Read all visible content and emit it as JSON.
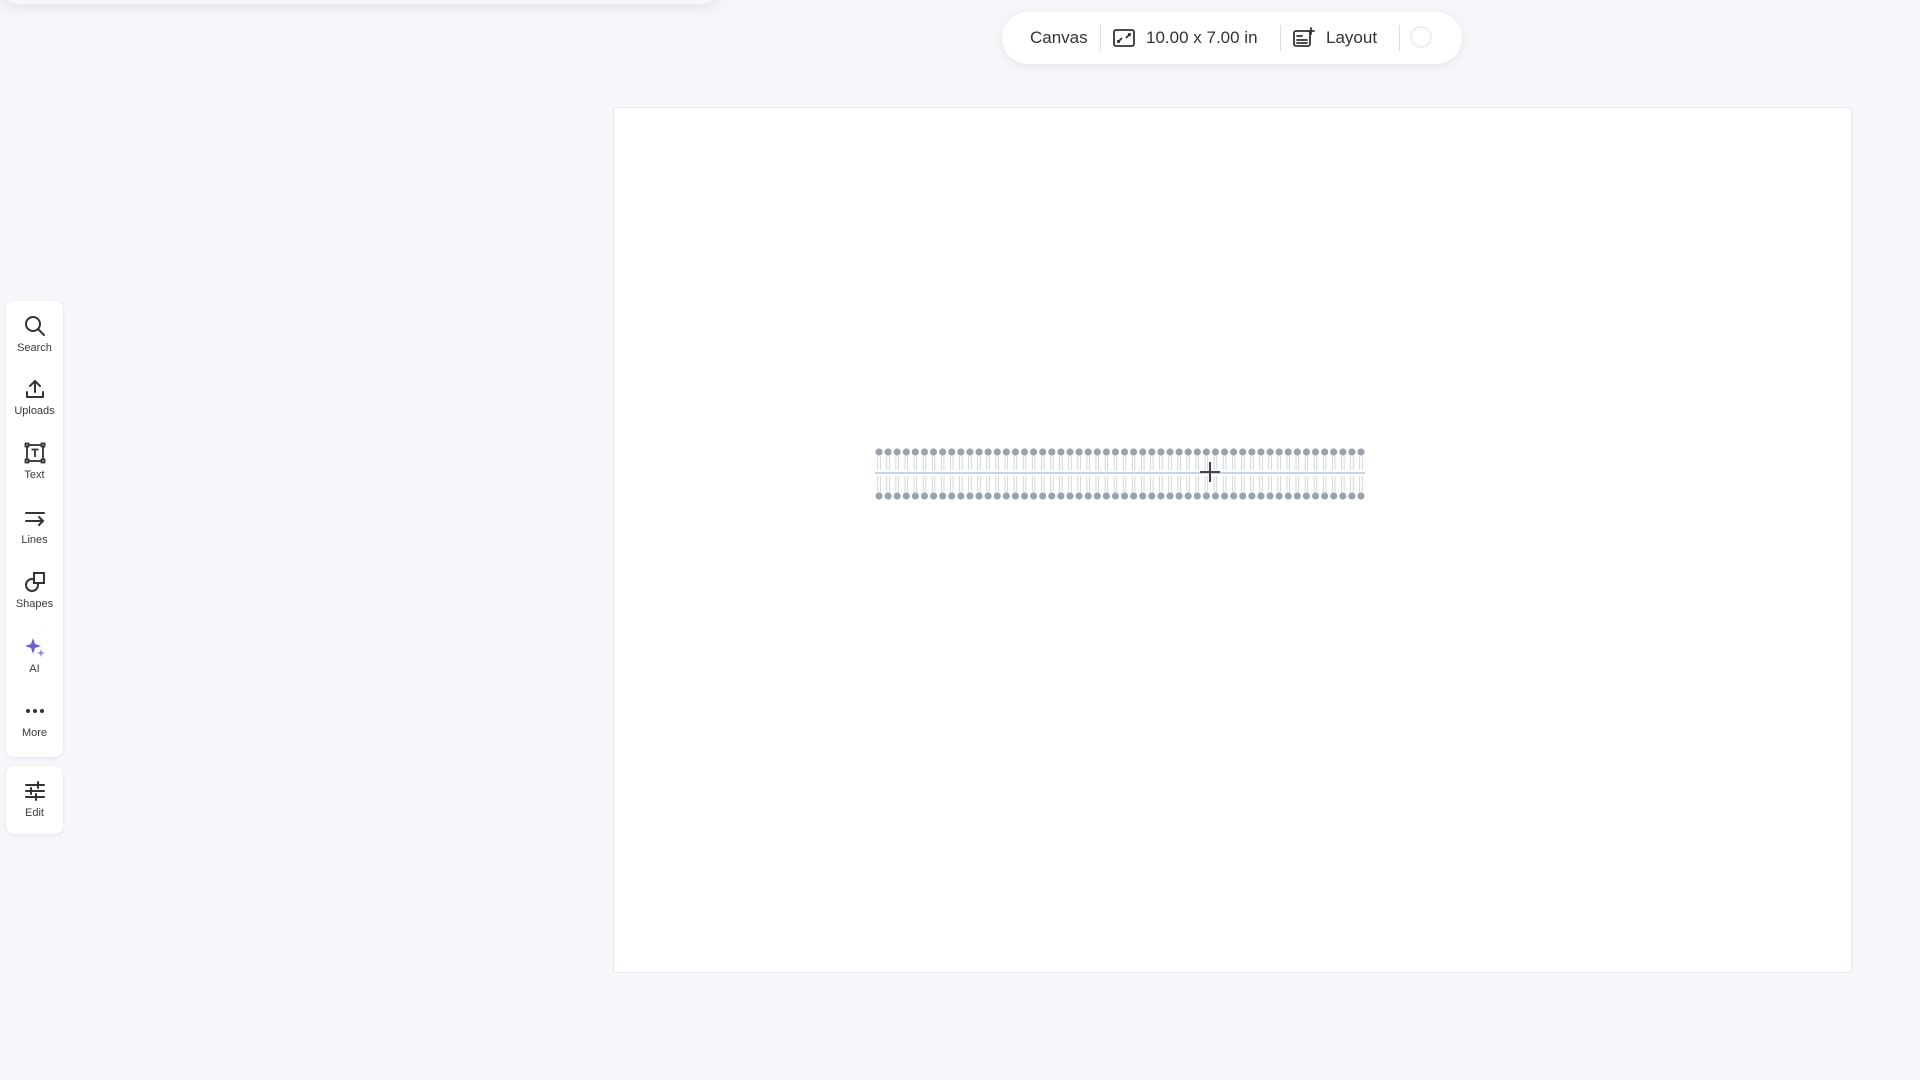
{
  "sidebar": {
    "items": [
      {
        "label": "Search",
        "icon": "search-icon"
      },
      {
        "label": "Uploads",
        "icon": "upload-icon"
      },
      {
        "label": "Text",
        "icon": "text-icon"
      },
      {
        "label": "Lines",
        "icon": "lines-icon"
      },
      {
        "label": "Shapes",
        "icon": "shapes-icon"
      },
      {
        "label": "AI",
        "icon": "ai-sparkle-icon"
      },
      {
        "label": "More",
        "icon": "more-icon"
      }
    ],
    "edit": {
      "label": "Edit",
      "icon": "edit-sliders-icon"
    }
  },
  "topbar": {
    "canvas_label": "Canvas",
    "size_label": "10.00 x 7.00 in",
    "layout_label": "Layout"
  },
  "colors": {
    "background": "#f5f7fa",
    "ai_accent": "#6b5fd6",
    "membrane_head": "#9aa3ab",
    "membrane_line": "#a9c8e8"
  }
}
